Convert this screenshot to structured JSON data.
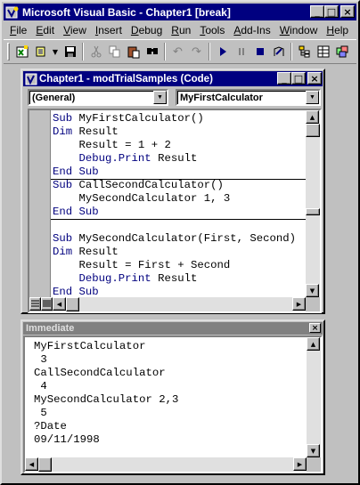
{
  "app": {
    "title": "Microsoft Visual Basic - Chapter1 [break]",
    "icon": "vba-app-icon"
  },
  "window_controls": {
    "minimize": "_",
    "maximize": "□",
    "close": "×"
  },
  "menu": {
    "items": [
      {
        "label": "File",
        "key": "F"
      },
      {
        "label": "Edit",
        "key": "E"
      },
      {
        "label": "View",
        "key": "V"
      },
      {
        "label": "Insert",
        "key": "I"
      },
      {
        "label": "Debug",
        "key": "D"
      },
      {
        "label": "Run",
        "key": "R"
      },
      {
        "label": "Tools",
        "key": "T"
      },
      {
        "label": "Add-Ins",
        "key": "A"
      },
      {
        "label": "Window",
        "key": "W"
      },
      {
        "label": "Help",
        "key": "H"
      }
    ]
  },
  "toolbar": {
    "icons": [
      "excel-view-icon",
      "insert-module-icon",
      "save-icon",
      "cut-icon",
      "copy-icon",
      "paste-icon",
      "find-icon",
      "undo-icon",
      "redo-icon",
      "run-icon",
      "break-icon",
      "reset-icon",
      "design-mode-icon",
      "project-explorer-icon",
      "properties-icon",
      "object-browser-icon"
    ]
  },
  "code_window": {
    "title": "Chapter1 - modTrialSamples (Code)",
    "object_combo": "(General)",
    "procedure_combo": "MyFirstCalculator",
    "lines": [
      {
        "kw": "Sub",
        "text": " MyFirstCalculator()"
      },
      {
        "kw": "Dim",
        "text": " Result"
      },
      {
        "kw": "",
        "text": "    Result = 1 + 2"
      },
      {
        "kw": "    Debug.Print",
        "text": " Result"
      },
      {
        "kw": "End Sub",
        "text": ""
      },
      {
        "kw": "Sub",
        "text": " CallSecondCalculator()"
      },
      {
        "kw": "",
        "text": "    MySecondCalculator 1, 3"
      },
      {
        "kw": "End Sub",
        "text": ""
      },
      {
        "kw": "",
        "text": ""
      },
      {
        "kw": "Sub",
        "text": " MySecondCalculator(First, Second)"
      },
      {
        "kw": "Dim",
        "text": " Result"
      },
      {
        "kw": "",
        "text": "    Result = First + Second"
      },
      {
        "kw": "    Debug.Print",
        "text": " Result"
      },
      {
        "kw": "End Sub",
        "text": ""
      }
    ]
  },
  "immediate_window": {
    "title": "Immediate",
    "close": "×",
    "lines": [
      "MyFirstCalculator",
      " 3",
      "CallSecondCalculator",
      " 4",
      "MySecondCalculator 2,3",
      " 5",
      "?Date",
      "09/11/1998"
    ]
  },
  "colors": {
    "titlebar": "#000080",
    "inactive_titlebar": "#808080",
    "keyword": "#00007f",
    "chrome": "#c0c0c0"
  }
}
